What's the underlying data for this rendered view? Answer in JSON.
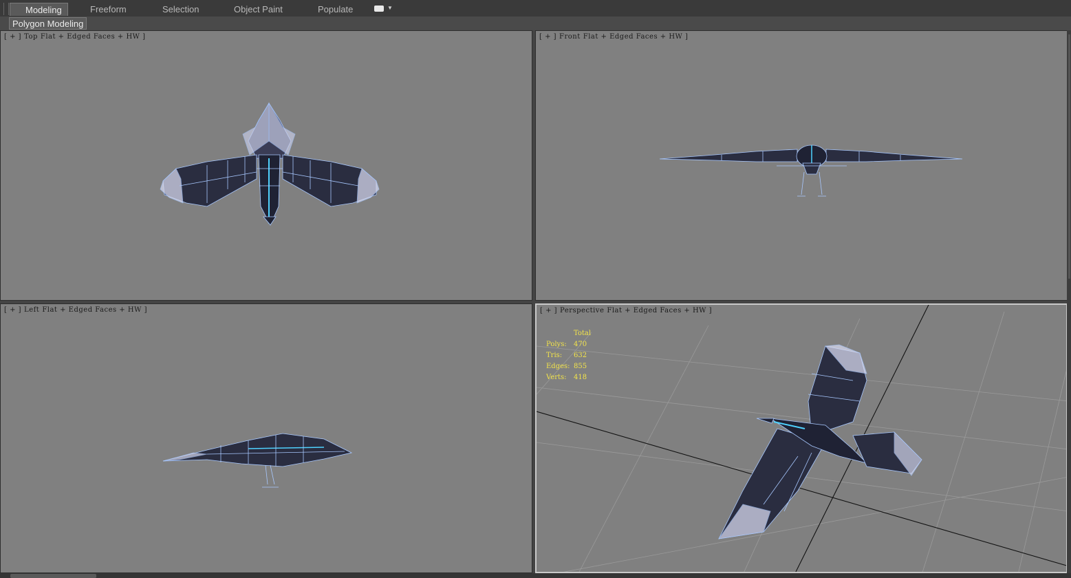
{
  "ribbon": {
    "tabs": [
      {
        "label": "Modeling",
        "active": true
      },
      {
        "label": "Freeform",
        "active": false
      },
      {
        "label": "Selection",
        "active": false
      },
      {
        "label": "Object Paint",
        "active": false
      },
      {
        "label": "Populate",
        "active": false
      }
    ],
    "more_icon": "expand-dropdown-icon"
  },
  "subbar": {
    "label": "Polygon Modeling"
  },
  "viewports": {
    "top": {
      "plus": "[ + ]",
      "view": "Top",
      "shading": "Flat + Edged Faces + HW ]"
    },
    "front": {
      "plus": "[ + ]",
      "view": "Front",
      "shading": "Flat + Edged Faces + HW ]"
    },
    "left": {
      "plus": "[ + ]",
      "view": "Left",
      "shading": "Flat + Edged Faces + HW ]"
    },
    "perspective": {
      "plus": "[ + ]",
      "view": "Perspective",
      "shading": "Flat + Edged Faces + HW ]"
    }
  },
  "stats": {
    "header": "Total",
    "polys_label": "Polys:",
    "polys": "470",
    "tris_label": "Tris:",
    "tris": "632",
    "edges_label": "Edges:",
    "edges": "855",
    "verts_label": "Verts:",
    "verts": "418"
  },
  "colors": {
    "viewport_bg": "#808080",
    "mesh_fill": "#2a2d40",
    "mesh_wire": "#a8c8ff",
    "feather_tip": "#d6d8ee",
    "glow": "#4fd2ff",
    "stats_text": "#f2e34a"
  }
}
